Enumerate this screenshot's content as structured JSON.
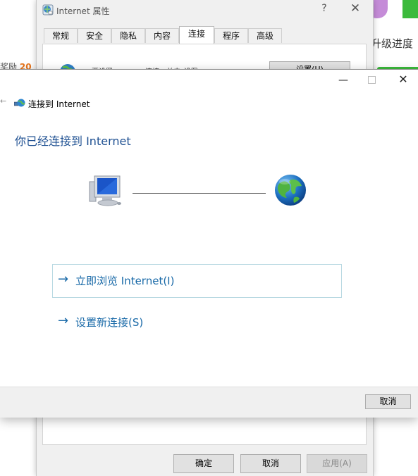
{
  "background_app": {
    "reward_label": "奖励",
    "reward_count": "20",
    "upgrade_text": "升级进度"
  },
  "properties_dialog": {
    "title": "Internet 属性",
    "help_glyph": "?",
    "close_glyph": "✕",
    "tabs": [
      {
        "label": "常规"
      },
      {
        "label": "安全"
      },
      {
        "label": "隐私"
      },
      {
        "label": "内容"
      },
      {
        "label": "连接",
        "active": true
      },
      {
        "label": "程序"
      },
      {
        "label": "高级"
      }
    ],
    "setup_button_label": "设置(U)",
    "setup_text": "要设置 Internet 连接，单击\"设置\"。",
    "buttons": {
      "ok": "确定",
      "cancel": "取消",
      "apply": "应用(A)"
    }
  },
  "wizard": {
    "minimize_glyph": "—",
    "close_glyph": "✕",
    "back_glyph": "←",
    "caption": "连接到 Internet",
    "heading": "你已经连接到 Internet",
    "options": {
      "browse_label": "立即浏览 Internet(I)",
      "new_connection_label": "设置新连接(S)",
      "arrow_glyph": "→"
    },
    "cancel_label": "取消"
  },
  "colors": {
    "heading_blue": "#1d4f91",
    "link_blue": "#1a6aa8",
    "option_border": "#b9d9e2",
    "reward_orange": "#e8741a",
    "accent_green": "#3cba3c"
  },
  "icons": {
    "properties_icon": "internet-options-icon",
    "wizard_icon": "network-globe-icon",
    "computer": "computer-icon",
    "globe": "globe-icon"
  }
}
